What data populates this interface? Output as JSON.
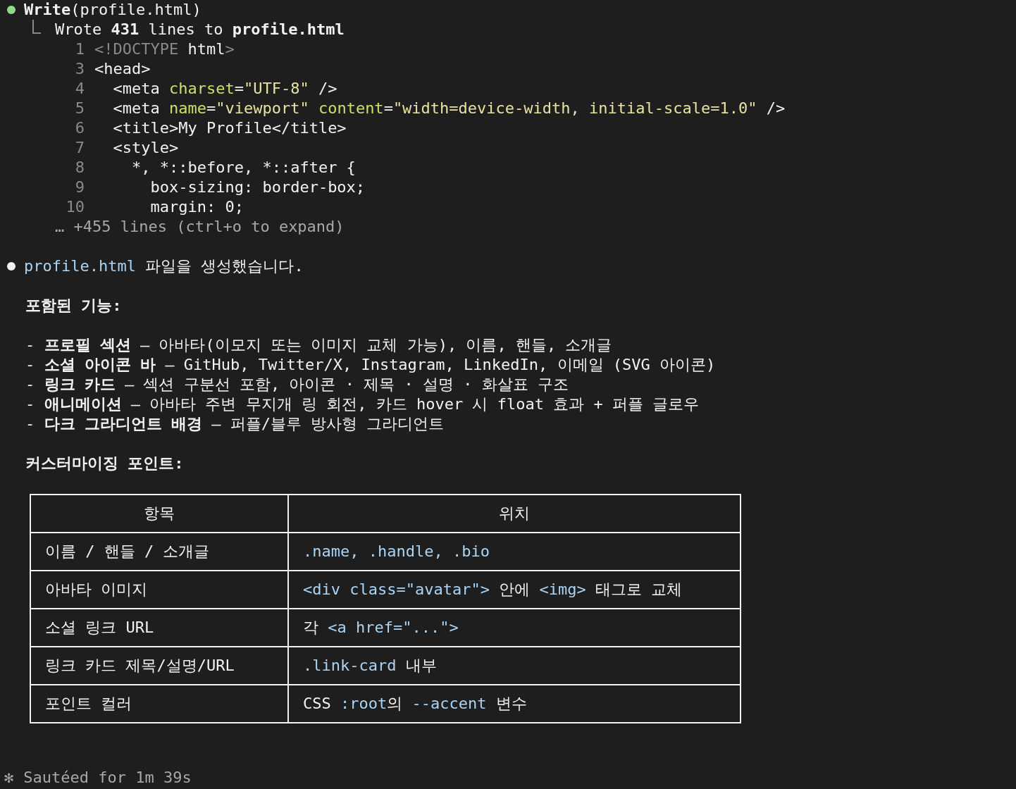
{
  "tool_call": {
    "title": "**Write**(profile.html)",
    "result": "Wrote **431** lines to **profile.html**",
    "code_lines": [
      {
        "number": "1",
        "tokens": [
          {
            "kind": "dim",
            "text": "<!DOCTYPE"
          },
          {
            "kind": "text",
            "text": " html"
          },
          {
            "kind": "dim",
            "text": ">"
          }
        ]
      },
      {
        "number": "3",
        "tokens": [
          {
            "kind": "text",
            "text": "<head>"
          }
        ]
      },
      {
        "number": "4",
        "tokens": [
          {
            "kind": "text",
            "text": "  <meta "
          },
          {
            "kind": "attr",
            "text": "charset"
          },
          {
            "kind": "text",
            "text": "="
          },
          {
            "kind": "string",
            "text": "\"UTF-8\""
          },
          {
            "kind": "text",
            "text": " />"
          }
        ]
      },
      {
        "number": "5",
        "tokens": [
          {
            "kind": "text",
            "text": "  <meta "
          },
          {
            "kind": "attr",
            "text": "name"
          },
          {
            "kind": "text",
            "text": "="
          },
          {
            "kind": "string",
            "text": "\"viewport\""
          },
          {
            "kind": "attr",
            "text": " content"
          },
          {
            "kind": "text",
            "text": "="
          },
          {
            "kind": "string",
            "text": "\"width=device-width, initial-scale=1.0\""
          },
          {
            "kind": "text",
            "text": " />"
          }
        ]
      },
      {
        "number": "6",
        "tokens": [
          {
            "kind": "text",
            "text": "  <title>My Profile</title>"
          }
        ]
      },
      {
        "number": "7",
        "tokens": [
          {
            "kind": "text",
            "text": "  <style>"
          }
        ]
      },
      {
        "number": "8",
        "tokens": [
          {
            "kind": "text",
            "text": "    *, *::before, *::after {"
          }
        ]
      },
      {
        "number": "9",
        "tokens": [
          {
            "kind": "text",
            "text": "      box-sizing: border-box;"
          }
        ]
      },
      {
        "number": "10",
        "tokens": [
          {
            "kind": "text",
            "text": "      margin: 0;"
          }
        ]
      }
    ],
    "collapsed": "… +455 lines (ctrl+o to expand)"
  },
  "message": {
    "tokens": [
      {
        "kind": "code",
        "text": "profile.html"
      },
      {
        "kind": "text",
        "text": " 파일을 생성했습니다."
      }
    ],
    "features_heading": "포함된 기능:",
    "features": [
      "- **프로필 섹션** — 아바타(이모지 또는 이미지 교체 가능), 이름, 핸들, 소개글",
      "- **소셜 아이콘 바** — GitHub, Twitter/X, Instagram, LinkedIn, 이메일 (SVG 아이콘)",
      "- **링크 카드** — 섹션 구분선 포함, 아이콘 · 제목 · 설명 · 화살표 구조",
      "- **애니메이션** — 아바타 주변 무지개 링 회전, 카드 hover 시 float 효과 + 퍼플 글로우",
      "- **다크 그라디언트 배경** — 퍼플/블루 방사형 그라디언트"
    ],
    "custom_heading": "커스터마이징 포인트:",
    "table": {
      "columns": [
        "항목",
        "위치"
      ],
      "rows": [
        [
          [
            {
              "kind": "text",
              "text": "이름 / 핸들 / 소개글"
            }
          ],
          [
            {
              "kind": "code",
              "text": ".name, .handle, .bio"
            }
          ]
        ],
        [
          [
            {
              "kind": "text",
              "text": "아바타 이미지"
            }
          ],
          [
            {
              "kind": "code",
              "text": "<div class=\"avatar\">"
            },
            {
              "kind": "text",
              "text": " 안에 "
            },
            {
              "kind": "code",
              "text": "<img>"
            },
            {
              "kind": "text",
              "text": " 태그로 교체"
            }
          ]
        ],
        [
          [
            {
              "kind": "text",
              "text": "소셜 링크 URL"
            }
          ],
          [
            {
              "kind": "text",
              "text": "각 "
            },
            {
              "kind": "code",
              "text": "<a href=\"...\">"
            }
          ]
        ],
        [
          [
            {
              "kind": "text",
              "text": "링크 카드 제목/설명/URL"
            }
          ],
          [
            {
              "kind": "code",
              "text": ".link-card"
            },
            {
              "kind": "text",
              "text": " 내부"
            }
          ]
        ],
        [
          [
            {
              "kind": "text",
              "text": "포인트 컬러"
            }
          ],
          [
            {
              "kind": "text",
              "text": "CSS "
            },
            {
              "kind": "code",
              "text": ":root"
            },
            {
              "kind": "text",
              "text": "의 "
            },
            {
              "kind": "code",
              "text": "--accent"
            },
            {
              "kind": "text",
              "text": " 변수"
            }
          ]
        ]
      ]
    }
  },
  "status": {
    "glyph": "✻",
    "text": "Sautéed for 1m 39s"
  }
}
